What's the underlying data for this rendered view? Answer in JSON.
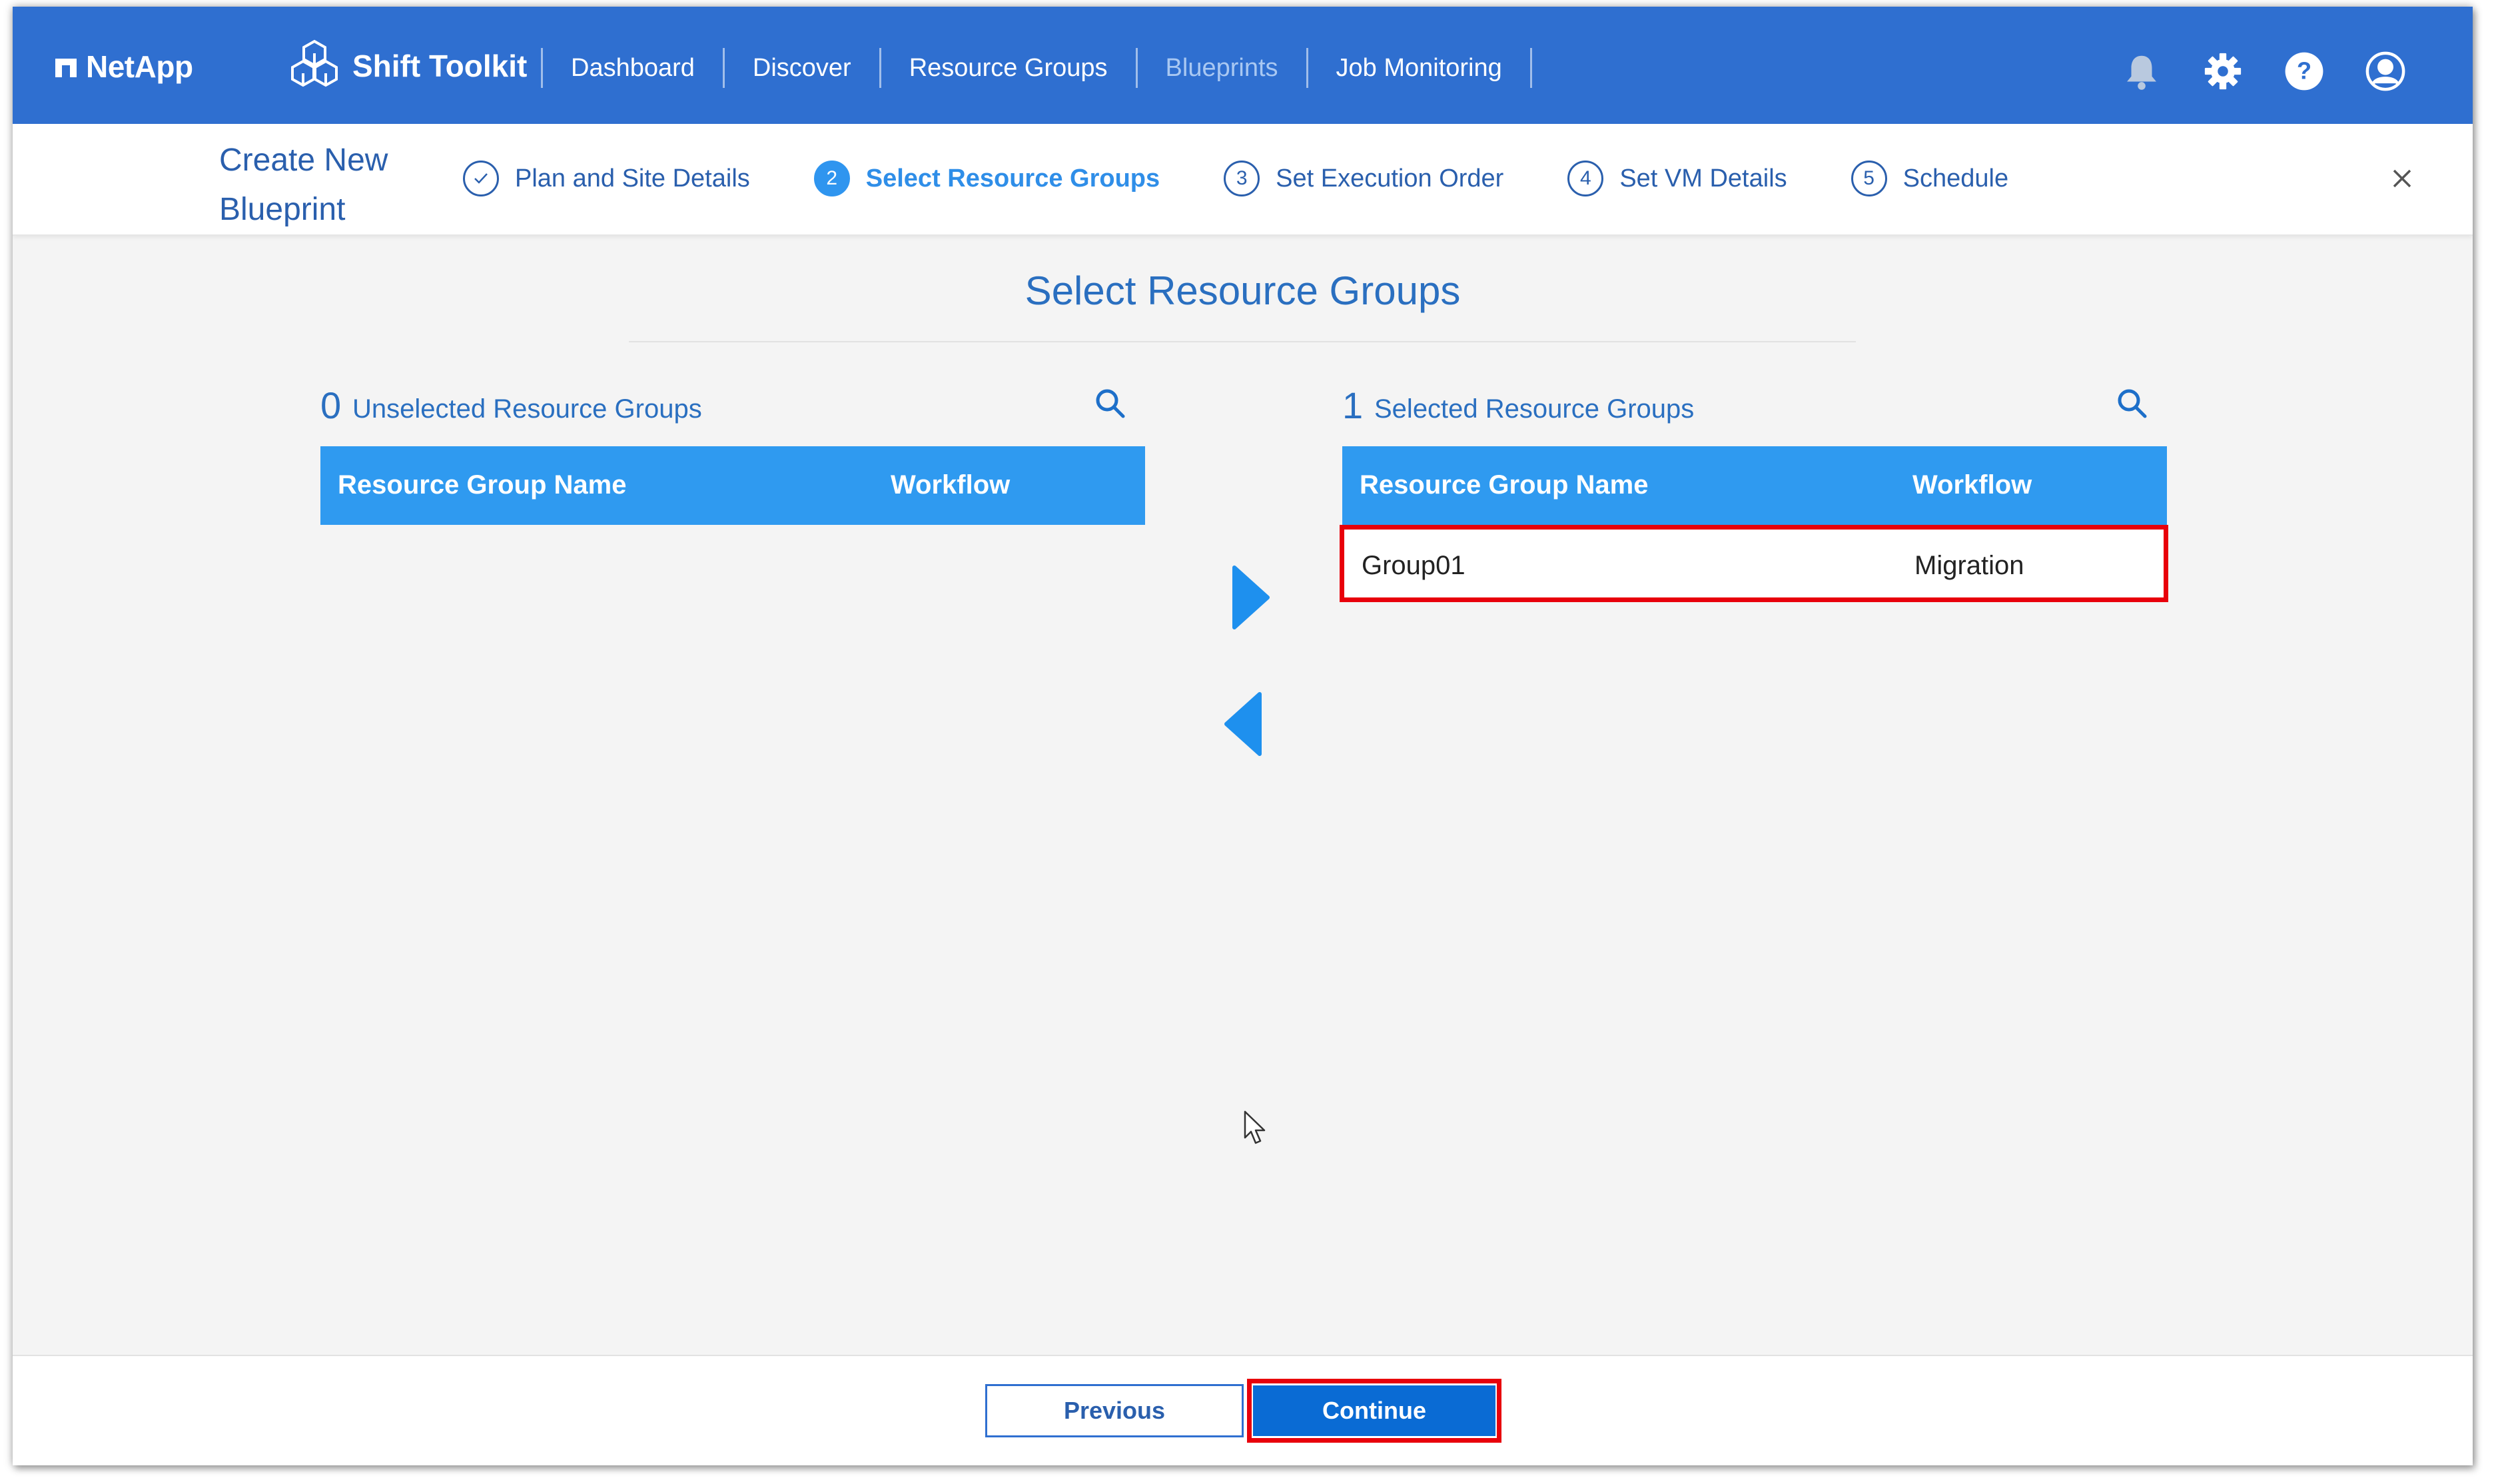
{
  "brand": {
    "name": "NetApp"
  },
  "product": {
    "name": "Shift Toolkit"
  },
  "nav": {
    "links": [
      {
        "label": "Dashboard"
      },
      {
        "label": "Discover"
      },
      {
        "label": "Resource Groups"
      },
      {
        "label": "Blueprints"
      },
      {
        "label": "Job Monitoring"
      }
    ],
    "active": "Blueprints",
    "icons": [
      "bell-icon",
      "gear-icon",
      "help-icon",
      "user-icon"
    ]
  },
  "wizard": {
    "title": "Create New Blueprint",
    "steps": [
      {
        "number": "✓",
        "label": "Plan and Site Details",
        "state": "done"
      },
      {
        "number": "2",
        "label": "Select Resource Groups",
        "state": "active"
      },
      {
        "number": "3",
        "label": "Set Execution Order",
        "state": "pending"
      },
      {
        "number": "4",
        "label": "Set VM Details",
        "state": "pending"
      },
      {
        "number": "5",
        "label": "Schedule",
        "state": "pending"
      }
    ]
  },
  "main": {
    "heading": "Select Resource Groups",
    "unselected": {
      "count": "0",
      "title": "Unselected Resource Groups",
      "columns": [
        "Resource Group Name",
        "Workflow"
      ],
      "rows": []
    },
    "selected": {
      "count": "1",
      "title": "Selected Resource Groups",
      "columns": [
        "Resource Group Name",
        "Workflow"
      ],
      "rows": [
        {
          "name": "Group01",
          "workflow": "Migration"
        }
      ]
    }
  },
  "footer": {
    "previous_label": "Previous",
    "continue_label": "Continue"
  },
  "colors": {
    "nav_bg": "#2f6fd0",
    "table_header": "#2f9af0",
    "primary_button": "#0a6bd4",
    "highlight": "#e8000b",
    "accent_text": "#2a6fc0"
  }
}
